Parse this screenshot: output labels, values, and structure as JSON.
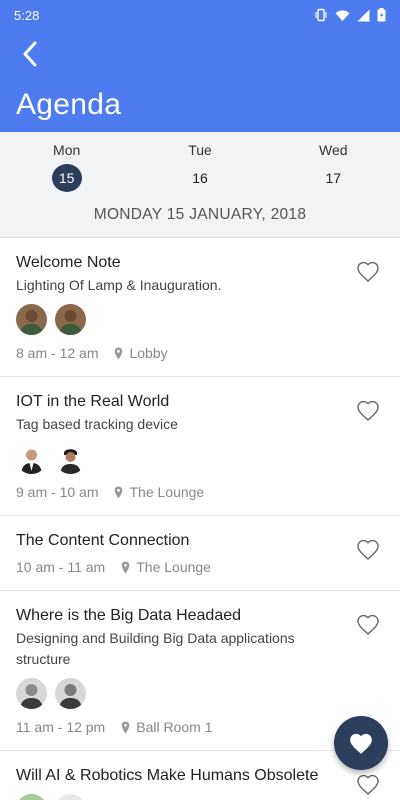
{
  "status_bar": {
    "time": "5:28"
  },
  "header": {
    "title": "Agenda"
  },
  "days": [
    {
      "name": "Mon",
      "num": "15",
      "selected": true
    },
    {
      "name": "Tue",
      "num": "16",
      "selected": false
    },
    {
      "name": "Wed",
      "num": "17",
      "selected": false
    }
  ],
  "date_header": "MONDAY 15 JANUARY, 2018",
  "sessions": [
    {
      "title": "Welcome Note",
      "desc": "Lighting Of Lamp & Inauguration.",
      "speakers": 2,
      "time": "8 am -  12 am",
      "location": "Lobby"
    },
    {
      "title": "IOT in the Real World",
      "desc": "Tag based tracking device",
      "speakers": 2,
      "time": "9 am -  10 am",
      "location": "The Lounge"
    },
    {
      "title": "The Content Connection",
      "desc": "",
      "speakers": 0,
      "time": "10 am -  11 am",
      "location": "The Lounge"
    },
    {
      "title": "Where is the Big Data Headaed",
      "desc": "Designing and Building Big Data applications structure",
      "speakers": 2,
      "time": "11 am -  12 pm",
      "location": "Ball Room 1"
    },
    {
      "title": "Will AI & Robotics Make Humans Obsolete",
      "desc": "",
      "speakers": 3,
      "time": "",
      "location": ""
    }
  ],
  "colors": {
    "primary": "#4d7cf1",
    "dark": "#2c3e5b",
    "muted": "#888888"
  },
  "icons": {
    "back": "chevron-left-icon",
    "favorite": "heart-outline-icon",
    "location": "map-pin-icon",
    "fab": "heart-filled-icon"
  }
}
